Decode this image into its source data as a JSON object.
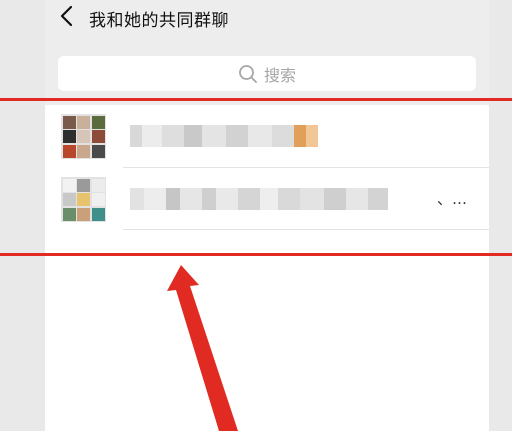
{
  "header": {
    "title": "我和她的共同群聊"
  },
  "search": {
    "placeholder": "搜索"
  },
  "groups": [
    {
      "name_visible": "",
      "avatar_icon": "group-avatar-icon"
    },
    {
      "name_visible": "、…",
      "avatar_icon": "group-avatar-icon"
    }
  ],
  "colors": {
    "annotation": "#e02a22",
    "background": "#ededed",
    "list_bg": "#ffffff",
    "placeholder": "#a6a6a6"
  }
}
